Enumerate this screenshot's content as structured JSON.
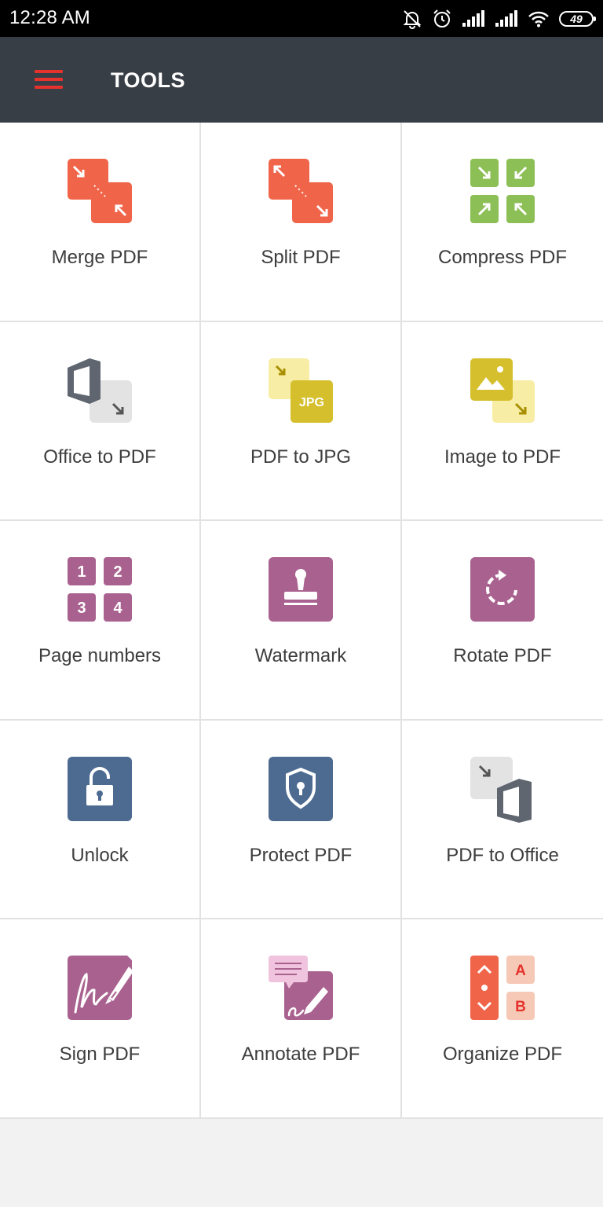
{
  "status_bar": {
    "time": "12:28 AM",
    "battery_level": "49",
    "icons": [
      "bell-off-icon",
      "alarm-icon",
      "signal-icon",
      "signal-icon",
      "wifi-icon",
      "battery-icon"
    ]
  },
  "app_bar": {
    "title": "TOOLS",
    "menu_icon": "hamburger-menu-icon",
    "accent_color": "#e5322d",
    "background_color": "#383e46"
  },
  "tools": [
    {
      "label": "Merge PDF",
      "icon": "merge-pdf-icon",
      "color": "#f0654a"
    },
    {
      "label": "Split PDF",
      "icon": "split-pdf-icon",
      "color": "#f0654a"
    },
    {
      "label": "Compress PDF",
      "icon": "compress-pdf-icon",
      "color": "#8cbf55"
    },
    {
      "label": "Office to PDF",
      "icon": "office-to-pdf-icon",
      "color": "#5f6670"
    },
    {
      "label": "PDF to JPG",
      "icon": "pdf-to-jpg-icon",
      "color": "#d6bf2d",
      "badge_text": "JPG"
    },
    {
      "label": "Image to PDF",
      "icon": "image-to-pdf-icon",
      "color": "#d6bf2d"
    },
    {
      "label": "Page numbers",
      "icon": "page-numbers-icon",
      "color": "#a9628f",
      "digits": [
        "1",
        "2",
        "3",
        "4"
      ]
    },
    {
      "label": "Watermark",
      "icon": "watermark-stamp-icon",
      "color": "#a9628f"
    },
    {
      "label": "Rotate PDF",
      "icon": "rotate-pdf-icon",
      "color": "#a9628f"
    },
    {
      "label": "Unlock",
      "icon": "unlock-padlock-icon",
      "color": "#4d6b91"
    },
    {
      "label": "Protect PDF",
      "icon": "protect-shield-icon",
      "color": "#4d6b91"
    },
    {
      "label": "PDF to Office",
      "icon": "pdf-to-office-icon",
      "color": "#5f6670"
    },
    {
      "label": "Sign PDF",
      "icon": "sign-pdf-icon",
      "color": "#a9628f"
    },
    {
      "label": "Annotate PDF",
      "icon": "annotate-pdf-icon",
      "color": "#a9628f"
    },
    {
      "label": "Organize PDF",
      "icon": "organize-pdf-icon",
      "color": "#f0654a",
      "letters": [
        "A",
        "B"
      ]
    }
  ]
}
